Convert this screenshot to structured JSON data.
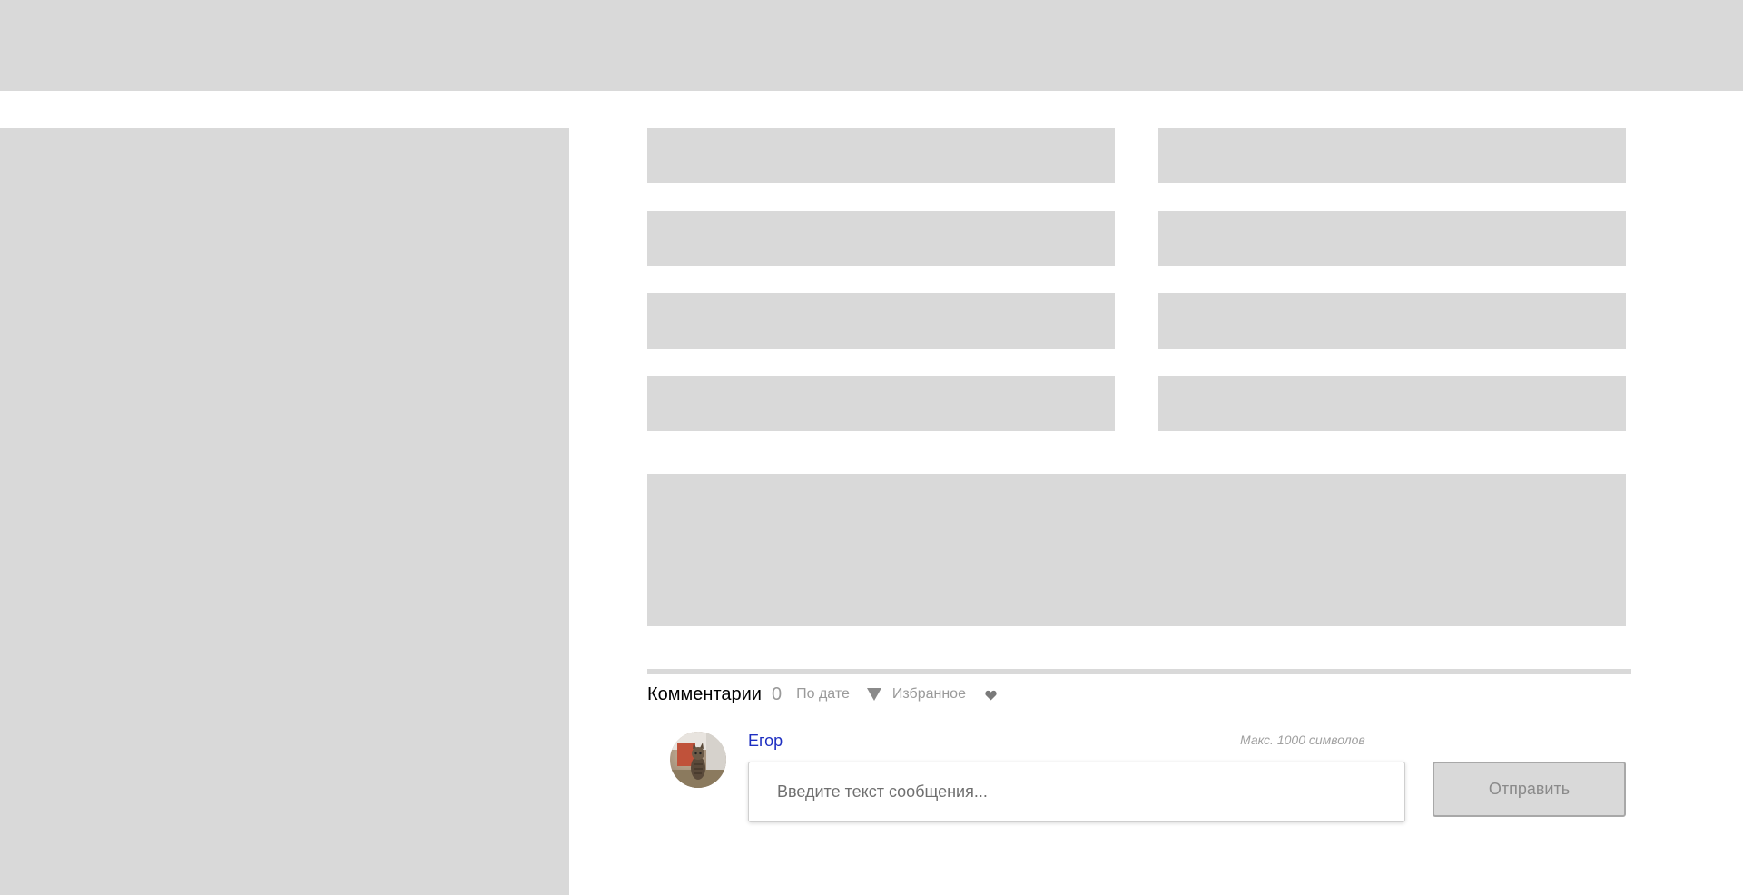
{
  "comments": {
    "title": "Комментарии",
    "count": "0",
    "sort_label": "По дате",
    "sort_icon": "triangle-down-icon",
    "favorites_label": "Избранное",
    "favorites_icon": "heart-icon"
  },
  "composer": {
    "username": "Егор",
    "max_hint": "Макс. 1000 символов",
    "placeholder": "Введите текст сообщения...",
    "send_label": "Отправить"
  },
  "colors": {
    "placeholder_gray": "#d9d9d9",
    "username_blue": "#1e2fc1",
    "muted_text": "#9a9a9a"
  }
}
